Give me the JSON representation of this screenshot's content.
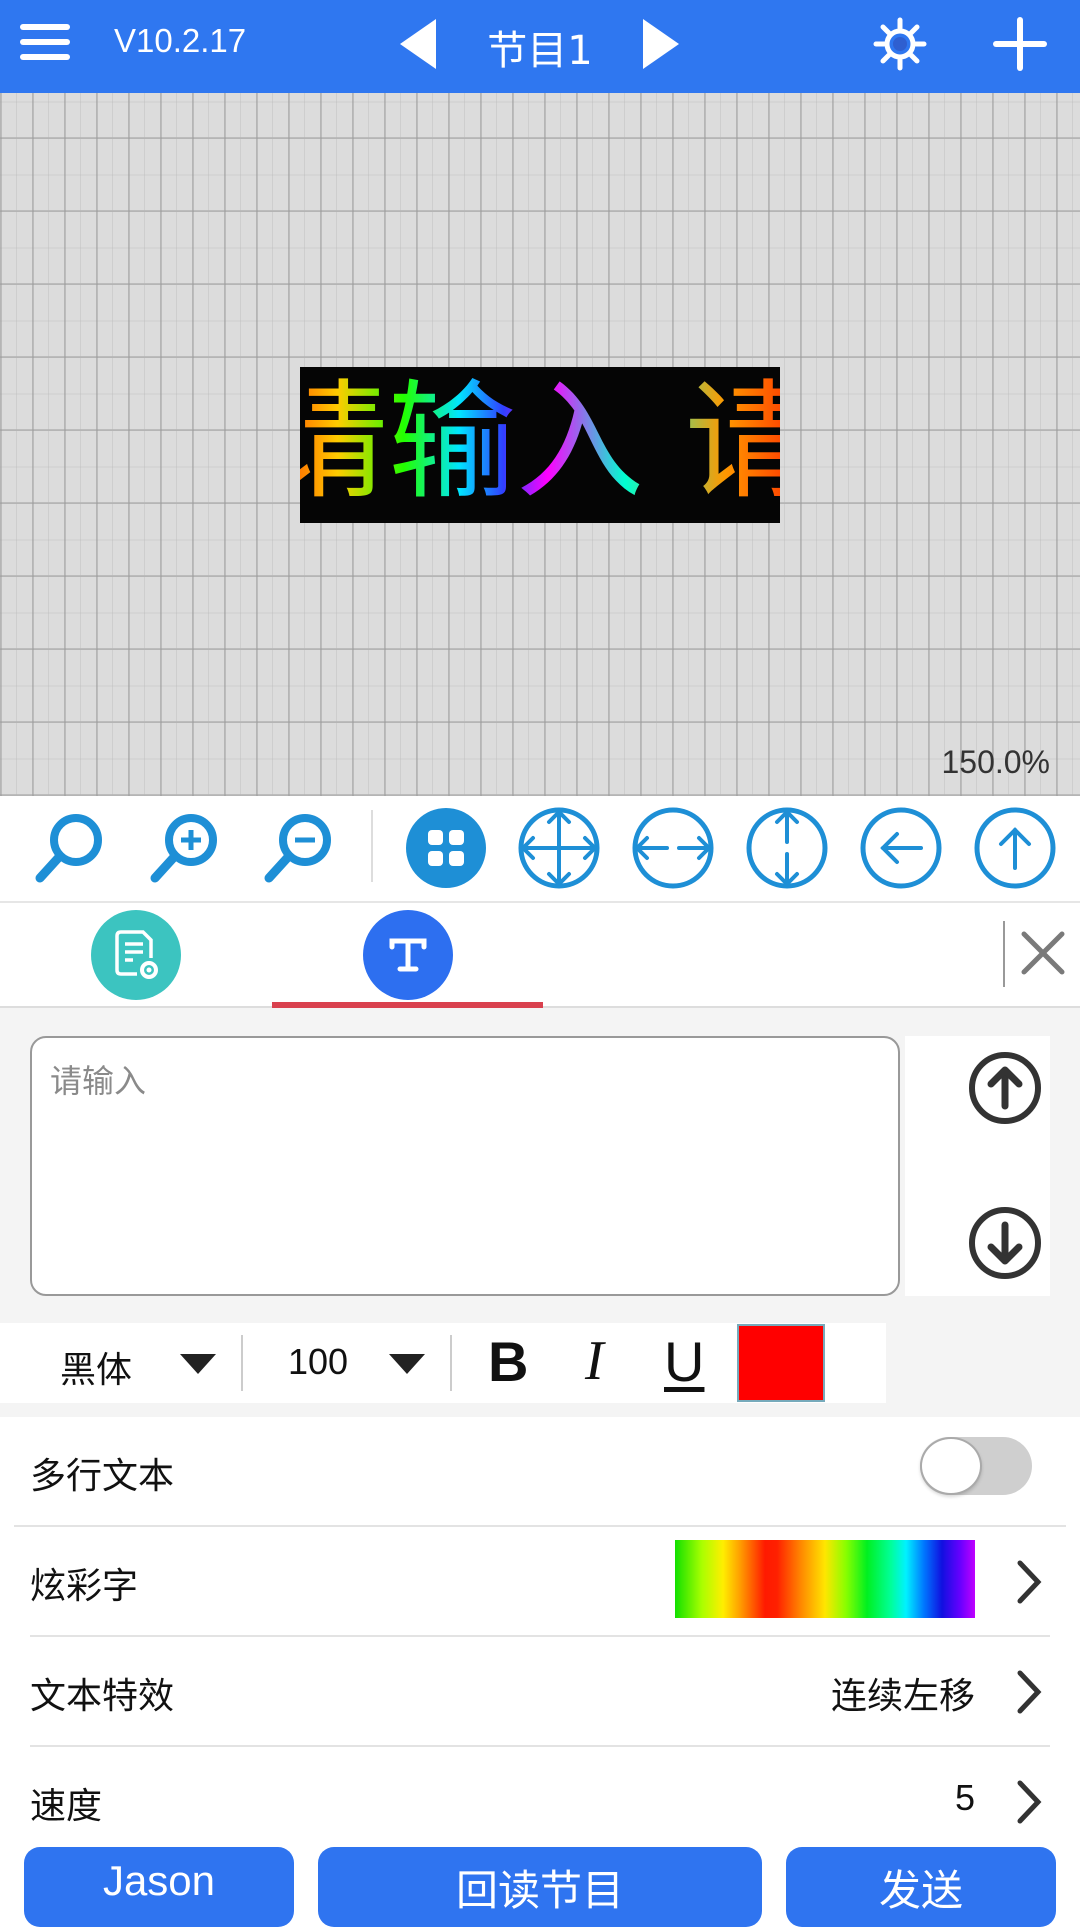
{
  "header": {
    "version": "V10.2.17",
    "program_title": "节目1",
    "icons": [
      "menu-icon",
      "prev-program-icon",
      "next-program-icon",
      "settings-gear-icon",
      "add-plus-icon"
    ]
  },
  "canvas": {
    "preview_text": "请输入 请",
    "zoom_level": "150.0%"
  },
  "toolbar": {
    "icons": [
      "zoom-fit-icon",
      "zoom-in-icon",
      "zoom-out-icon",
      "grid-align-icon",
      "move-all-directions-icon",
      "horizontal-center-icon",
      "vertical-center-icon",
      "align-left-icon",
      "align-top-icon"
    ]
  },
  "tabs": {
    "items": [
      {
        "icon": "program-settings-icon",
        "color": "#3cc4c0",
        "active": false
      },
      {
        "icon": "text-icon",
        "color": "#2d6ff0",
        "active": true
      }
    ],
    "close_icon": "close-icon",
    "active_underline_color": "#d9414e"
  },
  "editor": {
    "text_value": "",
    "placeholder": "请输入",
    "move_up_icon": "circle-arrow-up-icon",
    "move_down_icon": "circle-arrow-down-icon"
  },
  "font_row": {
    "font_family": "黑体",
    "font_size": "100",
    "bold": "B",
    "italic": "I",
    "underline": "U",
    "text_color": "#ff0000"
  },
  "settings": {
    "multiline": {
      "label": "多行文本",
      "enabled": false
    },
    "colorful_text": {
      "label": "炫彩字"
    },
    "text_effect": {
      "label": "文本特效",
      "value": "连续左移"
    },
    "speed": {
      "label": "速度",
      "value": "5"
    }
  },
  "bottom_buttons": {
    "jason": "Jason",
    "readback": "回读节目",
    "send": "发送"
  },
  "colors": {
    "primary": "#2f77f0",
    "toolbar_icon": "#1e8fd6"
  }
}
